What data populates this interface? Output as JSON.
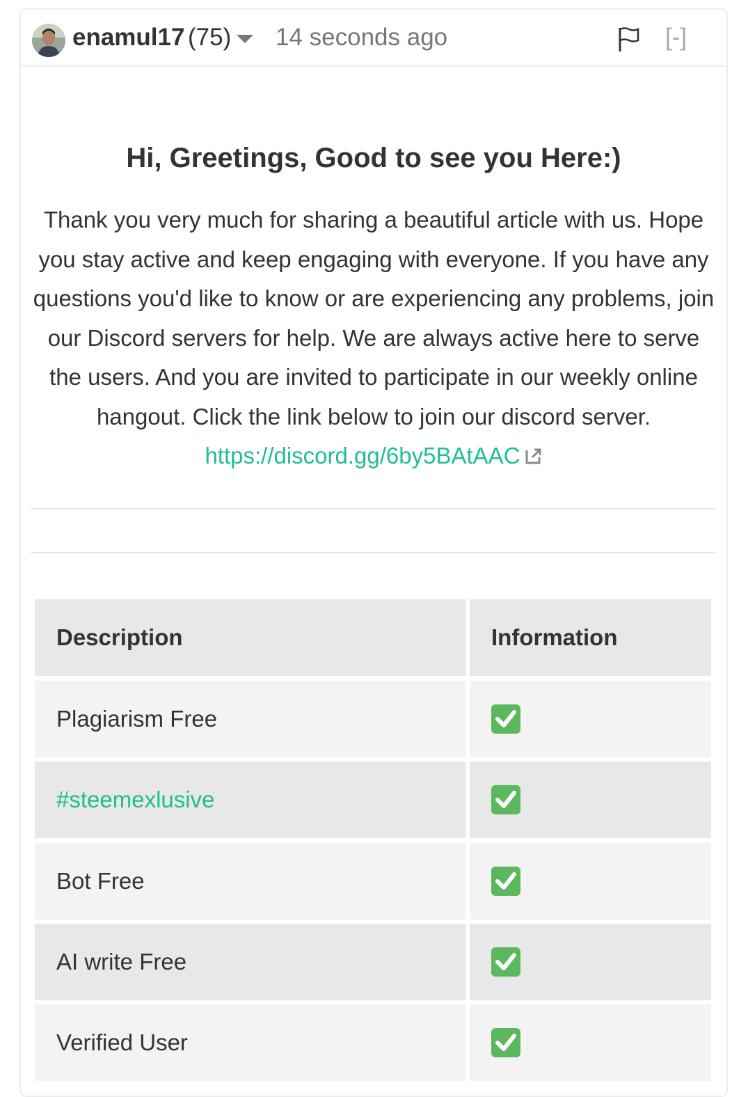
{
  "header": {
    "username": "enamul17",
    "reputation": "(75)",
    "timestamp": "14 seconds ago",
    "collapse_label": "[-]"
  },
  "content": {
    "heading": "Hi, Greetings, Good to see you Here:)",
    "paragraph": "Thank you very much for sharing a beautiful article with us. Hope you stay active and keep engaging with everyone. If you have any questions you'd like to know or are experiencing any problems, join our Discord servers for help. We are always active here to serve the users. And you are invited to participate in our weekly online hangout. Click the link below to join our discord server. ",
    "link_text": "https://discord.gg/6by5BAtAAC"
  },
  "table": {
    "headers": [
      "Description",
      "Information"
    ],
    "rows": [
      {
        "description": "Plagiarism Free",
        "information": "check"
      },
      {
        "description": "#steemexlusive",
        "information": "check"
      },
      {
        "description": "Bot Free",
        "information": "check"
      },
      {
        "description": "AI write Free",
        "information": "check"
      },
      {
        "description": "Verified User",
        "information": "check"
      }
    ]
  },
  "colors": {
    "link": "#1fbf8f",
    "check": "#5cb85c"
  }
}
